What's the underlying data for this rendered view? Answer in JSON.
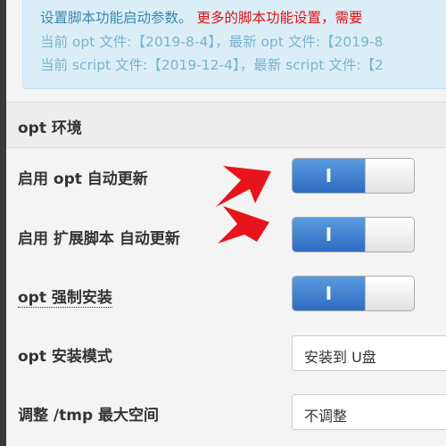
{
  "info": {
    "line1_text": "设置脚本功能启动参数。",
    "line1_red": "更多的脚本功能设置，需要",
    "line2": "当前 opt 文件:【2019-8-4】，最新 opt 文件:【2019-8",
    "line3": "当前 script 文件:【2019-12-4】，最新 script 文件:【2"
  },
  "section": {
    "title": "opt 环境"
  },
  "rows": [
    {
      "label": "启用 opt 自动更新",
      "toggle_on_label": "I"
    },
    {
      "label": "启用 扩展脚本 自动更新",
      "toggle_on_label": "I"
    },
    {
      "label": "opt 强制安装",
      "toggle_on_label": "I"
    },
    {
      "label": "opt 安装模式",
      "value": "安装到 U盘"
    },
    {
      "label": "调整 /tmp 最大空间",
      "value": "不调整"
    }
  ],
  "colors": {
    "accent": "#3a87ad",
    "warning": "#e01010",
    "toggle_on": "#2e6cc2",
    "arrow": "#e8141b"
  }
}
